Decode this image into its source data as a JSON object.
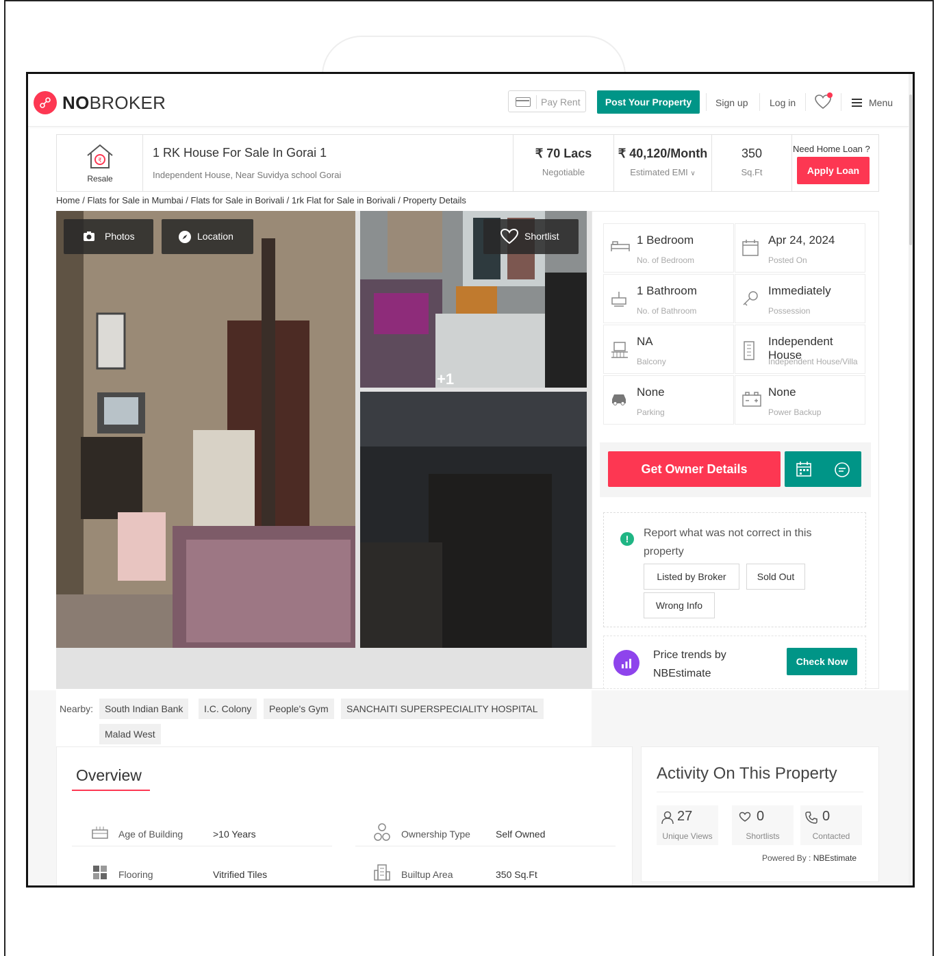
{
  "header": {
    "logo_bold": "NO",
    "logo_rest": "BROKER",
    "pay_rent": "Pay Rent",
    "post_property": "Post Your Property",
    "sign_up": "Sign up",
    "log_in": "Log in",
    "menu": "Menu"
  },
  "listing": {
    "category": "Resale",
    "title": "1 RK House For Sale In Gorai 1",
    "subtitle": "Independent House, Near Suvidya school Gorai",
    "price": "₹ 70 Lacs",
    "price_note": "Negotiable",
    "emi": "₹ 40,120/Month",
    "emi_note": "Estimated EMI",
    "area": "350",
    "area_unit": "Sq.Ft",
    "loan_question": "Need Home Loan ?",
    "apply_loan": "Apply Loan"
  },
  "breadcrumb": "Home / Flats for Sale in Mumbai / Flats for Sale in Borivali / 1rk Flat for Sale in Borivali / Property Details",
  "gallery": {
    "photos": "Photos",
    "location": "Location",
    "shortlist": "Shortlist",
    "more": "+1"
  },
  "details": [
    {
      "value": "1 Bedroom",
      "label": "No. of Bedroom",
      "icon": "bed-icon"
    },
    {
      "value": "Apr 24, 2024",
      "label": "Posted On",
      "icon": "calendar-icon"
    },
    {
      "value": "1 Bathroom",
      "label": "No. of Bathroom",
      "icon": "bathtub-icon"
    },
    {
      "value": "Immediately",
      "label": "Possession",
      "icon": "key-icon"
    },
    {
      "value": "NA",
      "label": "Balcony",
      "icon": "balcony-icon"
    },
    {
      "value": "Independent House",
      "label": "Independent House/Villa",
      "icon": "building-icon"
    },
    {
      "value": "None",
      "label": "Parking",
      "icon": "car-icon"
    },
    {
      "value": "None",
      "label": "Power Backup",
      "icon": "battery-icon"
    }
  ],
  "contact": {
    "get_owner": "Get Owner Details"
  },
  "report": {
    "question": "Report what was not correct in this property",
    "options": [
      "Listed by Broker",
      "Sold Out",
      "Wrong Info"
    ]
  },
  "trends": {
    "text": "Price trends by NBEstimate",
    "button": "Check Now"
  },
  "nearby": {
    "label": "Nearby:",
    "places": [
      "South Indian Bank",
      "I.C. Colony",
      "People's Gym",
      "SANCHAITI SUPERSPECIALITY HOSPITAL",
      "Malad West"
    ]
  },
  "overview": {
    "title": "Overview",
    "rows": [
      {
        "label": "Age of Building",
        "value": ">10 Years",
        "icon": "building-age-icon"
      },
      {
        "label": "Ownership Type",
        "value": "Self Owned",
        "icon": "ownership-icon"
      },
      {
        "label": "Flooring",
        "value": "Vitrified Tiles",
        "icon": "flooring-icon"
      },
      {
        "label": "Builtup Area",
        "value": "350 Sq.Ft",
        "icon": "area-icon"
      }
    ]
  },
  "activity": {
    "title": "Activity On This Property",
    "stats": [
      {
        "value": "27",
        "label": "Unique Views",
        "icon": "user-icon"
      },
      {
        "value": "0",
        "label": "Shortlists",
        "icon": "heart-icon"
      },
      {
        "value": "0",
        "label": "Contacted",
        "icon": "phone-icon"
      }
    ],
    "powered_by": "Powered By :",
    "powered_brand": "NBEstimate"
  },
  "colors": {
    "brand_red": "#fd3752",
    "brand_green": "#009587",
    "purple": "#8e44ec"
  }
}
